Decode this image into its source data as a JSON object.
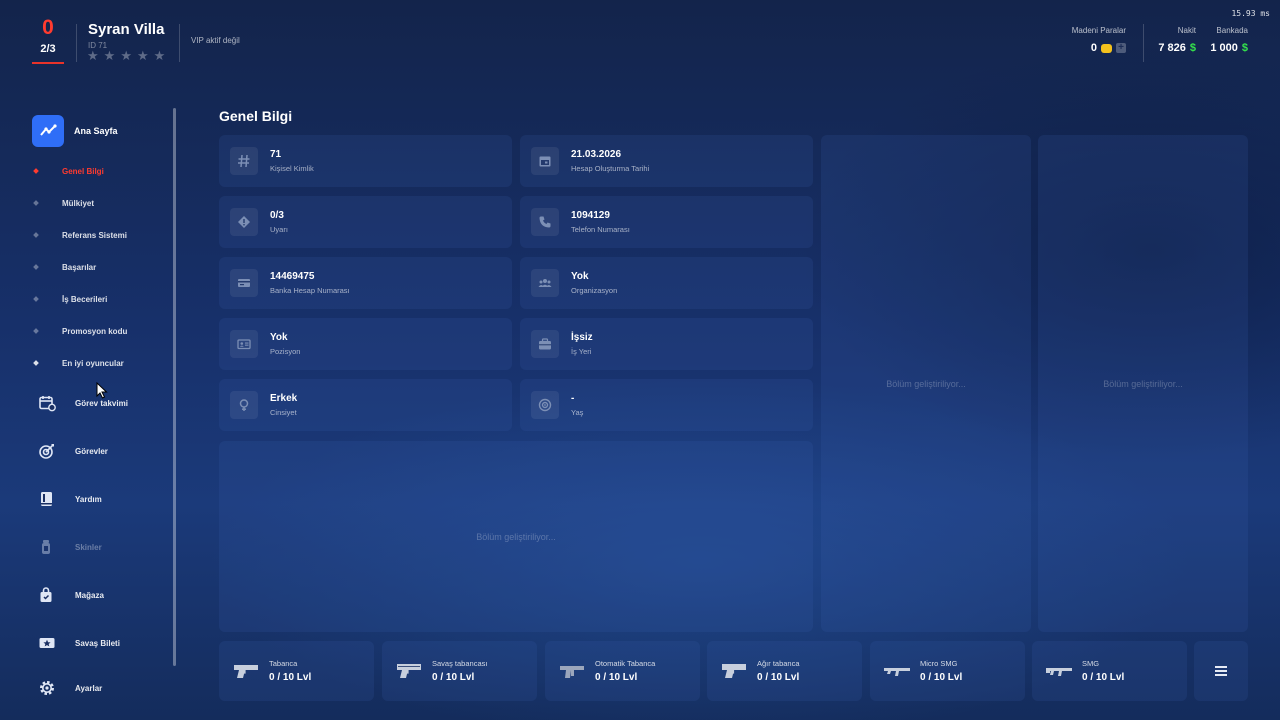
{
  "header": {
    "level": "0",
    "level_progress": "2/3",
    "player_name": "Syran Villa",
    "player_id": "ID 71",
    "star_count": 5,
    "vip_status": "VIP aktif değil",
    "fps_readout": "15.93 ms",
    "currencies": {
      "coins_label": "Madeni Paralar",
      "coins_value": "0",
      "cash_label": "Nakit",
      "cash_value": "7 826",
      "bank_label": "Bankada",
      "bank_value": "1 000",
      "currency_symbol": "$"
    }
  },
  "sidebar": {
    "home_label": "Ana Sayfa",
    "sub_items": [
      {
        "label": "Genel Bilgi",
        "active": true
      },
      {
        "label": "Mülkiyet"
      },
      {
        "label": "Referans Sistemi"
      },
      {
        "label": "Başarılar"
      },
      {
        "label": "İş Becerileri"
      },
      {
        "label": "Promosyon kodu"
      },
      {
        "label": "En iyi oyuncular"
      }
    ],
    "nav_items": [
      {
        "label": "Görev takvimi",
        "icon": "calendar-icon"
      },
      {
        "label": "Görevler",
        "icon": "target-icon"
      },
      {
        "label": "Yardım",
        "icon": "book-icon"
      },
      {
        "label": "Skinler",
        "icon": "skin-icon",
        "disabled": true
      },
      {
        "label": "Mağaza",
        "icon": "shopping-bag-icon"
      },
      {
        "label": "Savaş Bileti",
        "icon": "ticket-star-icon"
      },
      {
        "label": "Ayarlar",
        "icon": "gear-icon"
      }
    ]
  },
  "main": {
    "section_title": "Genel Bilgi",
    "info_cards": [
      {
        "value": "71",
        "label": "Kişisel Kimlik",
        "icon": "hash-icon"
      },
      {
        "value": "21.03.2026",
        "label": "Hesap Oluşturma Tarihi",
        "icon": "calendar-icon"
      },
      {
        "value": "0/3",
        "label": "Uyarı",
        "icon": "warning-icon"
      },
      {
        "value": "1094129",
        "label": "Telefon Numarası",
        "icon": "phone-icon"
      },
      {
        "value": "14469475",
        "label": "Banka Hesap Numarası",
        "icon": "bank-card-icon"
      },
      {
        "value": "Yok",
        "label": "Organizasyon",
        "icon": "group-icon"
      },
      {
        "value": "Yok",
        "label": "Pozisyon",
        "icon": "id-card-icon"
      },
      {
        "value": "İşsiz",
        "label": "İş Yeri",
        "icon": "briefcase-icon"
      },
      {
        "value": "Erkek",
        "label": "Cinsiyet",
        "icon": "gender-icon"
      },
      {
        "value": "-",
        "label": "Yaş",
        "icon": "age-icon"
      }
    ],
    "under_development_text": "Bölüm geliştiriliyor..."
  },
  "weapons": [
    {
      "name": "Tabanca",
      "level": "0 / 10 Lvl",
      "icon": "pistol-icon"
    },
    {
      "name": "Savaş tabancası",
      "level": "0 / 10 Lvl",
      "icon": "combat-pistol-icon"
    },
    {
      "name": "Otomatik Tabanca",
      "level": "0 / 10 Lvl",
      "icon": "auto-pistol-icon"
    },
    {
      "name": "Ağır tabanca",
      "level": "0 / 10 Lvl",
      "icon": "heavy-pistol-icon"
    },
    {
      "name": "Micro SMG",
      "level": "0 / 10 Lvl",
      "icon": "micro-smg-icon"
    },
    {
      "name": "SMG",
      "level": "0 / 10 Lvl",
      "icon": "smg-icon"
    }
  ],
  "colors": {
    "accent_red": "#ff3b2f",
    "home_blue": "#2f6ef7",
    "money_green": "#35e34c",
    "coin_gold": "#f4c21d"
  }
}
